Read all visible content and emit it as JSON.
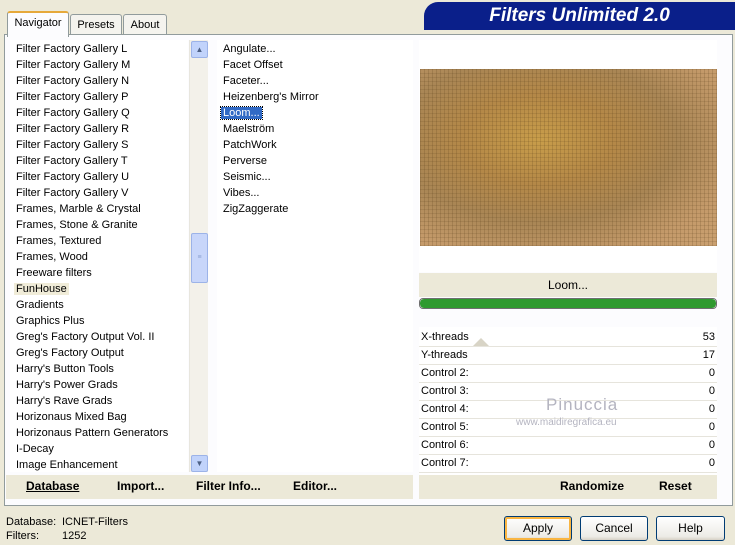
{
  "window": {
    "title": "Filters Unlimited 2.0"
  },
  "tabs": [
    {
      "label": "Navigator",
      "active": true
    },
    {
      "label": "Presets",
      "active": false
    },
    {
      "label": "About",
      "active": false
    }
  ],
  "categories": {
    "items": [
      "Filter Factory Gallery L",
      "Filter Factory Gallery M",
      "Filter Factory Gallery N",
      "Filter Factory Gallery P",
      "Filter Factory Gallery Q",
      "Filter Factory Gallery R",
      "Filter Factory Gallery S",
      "Filter Factory Gallery T",
      "Filter Factory Gallery U",
      "Filter Factory Gallery V",
      "Frames, Marble & Crystal",
      "Frames, Stone & Granite",
      "Frames, Textured",
      "Frames, Wood",
      "Freeware filters",
      "FunHouse",
      "Gradients",
      "Graphics Plus",
      "Greg's Factory Output Vol. II",
      "Greg's Factory Output",
      "Harry's Button Tools",
      "Harry's Power Grads",
      "Harry's Rave Grads",
      "Horizonaus Mixed Bag",
      "Horizonaus Pattern Generators",
      "I-Decay",
      "Image Enhancement"
    ],
    "selected_index": 15
  },
  "filters": {
    "items": [
      "Angulate...",
      "Facet Offset",
      "Faceter...",
      "Heizenberg's Mirror",
      "Loom...",
      "Maelström",
      "PatchWork",
      "Perverse",
      "Seismic...",
      "Vibes...",
      "ZigZaggerate"
    ],
    "selected_index": 4
  },
  "left_actions": {
    "database": "Database",
    "import": "Import...",
    "filter_info": "Filter Info...",
    "editor": "Editor..."
  },
  "right_actions": {
    "randomize": "Randomize",
    "reset": "Reset"
  },
  "preview": {
    "filter_name": "Loom...",
    "progress": 1.0
  },
  "controls": [
    {
      "label": "X-threads",
      "value": "53"
    },
    {
      "label": "Y-threads",
      "value": "17"
    },
    {
      "label": "Control 2:",
      "value": "0"
    },
    {
      "label": "Control 3:",
      "value": "0"
    },
    {
      "label": "Control 4:",
      "value": "0"
    },
    {
      "label": "Control 5:",
      "value": "0"
    },
    {
      "label": "Control 6:",
      "value": "0"
    },
    {
      "label": "Control 7:",
      "value": "0"
    }
  ],
  "watermark": {
    "name": "Pinuccia",
    "url": "www.maidiregrafica.eu"
  },
  "status": {
    "database_label": "Database:",
    "database_value": "ICNET-Filters",
    "filters_label": "Filters:",
    "filters_value": "1252"
  },
  "buttons": {
    "apply": "Apply",
    "cancel": "Cancel",
    "help": "Help"
  },
  "colors": {
    "title_bar": "#0a1f8a",
    "selection": "#316ac5",
    "tab_highlight": "#e6a93a"
  }
}
